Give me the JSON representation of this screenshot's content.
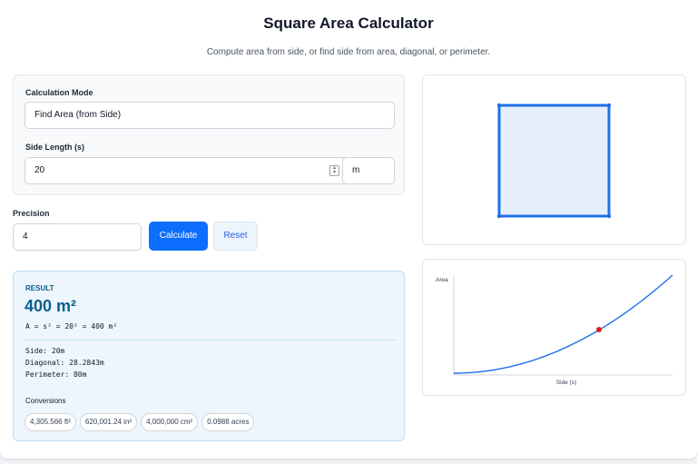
{
  "header": {
    "title": "Square Area Calculator",
    "subtitle": "Compute area from side, or find side from area, diagonal, or perimeter."
  },
  "form": {
    "mode_label": "Calculation Mode",
    "mode_value": "Find Area (from Side)",
    "side_label": "Side Length (s)",
    "side_value": "20",
    "unit_value": "m",
    "precision_label": "Precision",
    "precision_value": "4",
    "calculate_label": "Calculate",
    "reset_label": "Reset"
  },
  "result": {
    "heading": "RESULT",
    "value": "400 m²",
    "formula": "A = s² = 20² = 400 m²",
    "side": "Side: 20m",
    "diagonal": "Diagonal: 28.2843m",
    "perimeter": "Perimeter: 80m",
    "conversions_label": "Conversions",
    "conversions": [
      "4,305.566 ft²",
      "620,001.24 in²",
      "4,000,000 cm²",
      "0.0988 acres"
    ]
  },
  "graph": {
    "ylabel": "Area",
    "xlabel": "Side (s)"
  },
  "colors": {
    "accent": "#0d6efd",
    "square_fill": "#e6effc",
    "square_stroke": "#1f6feb",
    "curve": "#1f6feb",
    "marker": "#e11d1d"
  }
}
